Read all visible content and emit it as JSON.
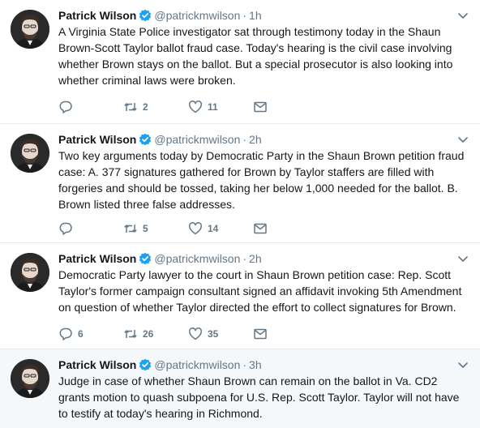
{
  "tweets": [
    {
      "author_name": "Patrick Wilson",
      "handle": "@patrickmwilson",
      "separator": "·",
      "time": "1h",
      "text": "A Virginia State Police investigator sat through testimony today in the Shaun Brown-Scott Taylor ballot fraud case. Today's hearing is the civil case involving whether Brown stays on the ballot. But a special prosecutor is also looking into whether criminal laws were broken.",
      "replies": "",
      "retweets": "2",
      "likes": "11"
    },
    {
      "author_name": "Patrick Wilson",
      "handle": "@patrickmwilson",
      "separator": "·",
      "time": "2h",
      "text": "Two key arguments today by Democratic Party in the Shaun Brown petition fraud case: A. 377 signatures gathered for Brown by Taylor staffers are filled with forgeries and should be tossed, taking her below 1,000 needed for the ballot. B. Brown listed three false addresses.",
      "replies": "",
      "retweets": "5",
      "likes": "14"
    },
    {
      "author_name": "Patrick Wilson",
      "handle": "@patrickmwilson",
      "separator": "·",
      "time": "2h",
      "text": "Democratic Party lawyer to the court in Shaun Brown petition case: Rep. Scott Taylor's former campaign consultant signed an affidavit invoking 5th Amendment on question of whether Taylor directed the effort to collect signatures for Brown.",
      "replies": "6",
      "retweets": "26",
      "likes": "35"
    },
    {
      "author_name": "Patrick Wilson",
      "handle": "@patrickmwilson",
      "separator": "·",
      "time": "3h",
      "text": "Judge in case of whether Shaun Brown can remain on the ballot in Va. CD2 grants motion to quash subpoena for U.S. Rep. Scott Taylor. Taylor will not have to testify at today's hearing in Richmond.",
      "replies": "",
      "retweets": "",
      "likes": ""
    }
  ],
  "icons": {
    "verified": "verified-badge-icon",
    "caret": "chevron-down-icon",
    "reply": "reply-icon",
    "retweet": "retweet-icon",
    "like": "heart-icon",
    "dm": "envelope-icon"
  },
  "colors": {
    "text": "#14171a",
    "secondary": "#657786",
    "verified": "#1da1f2",
    "divider": "#e6ecf0",
    "unread_bg": "#f5f8fa"
  }
}
